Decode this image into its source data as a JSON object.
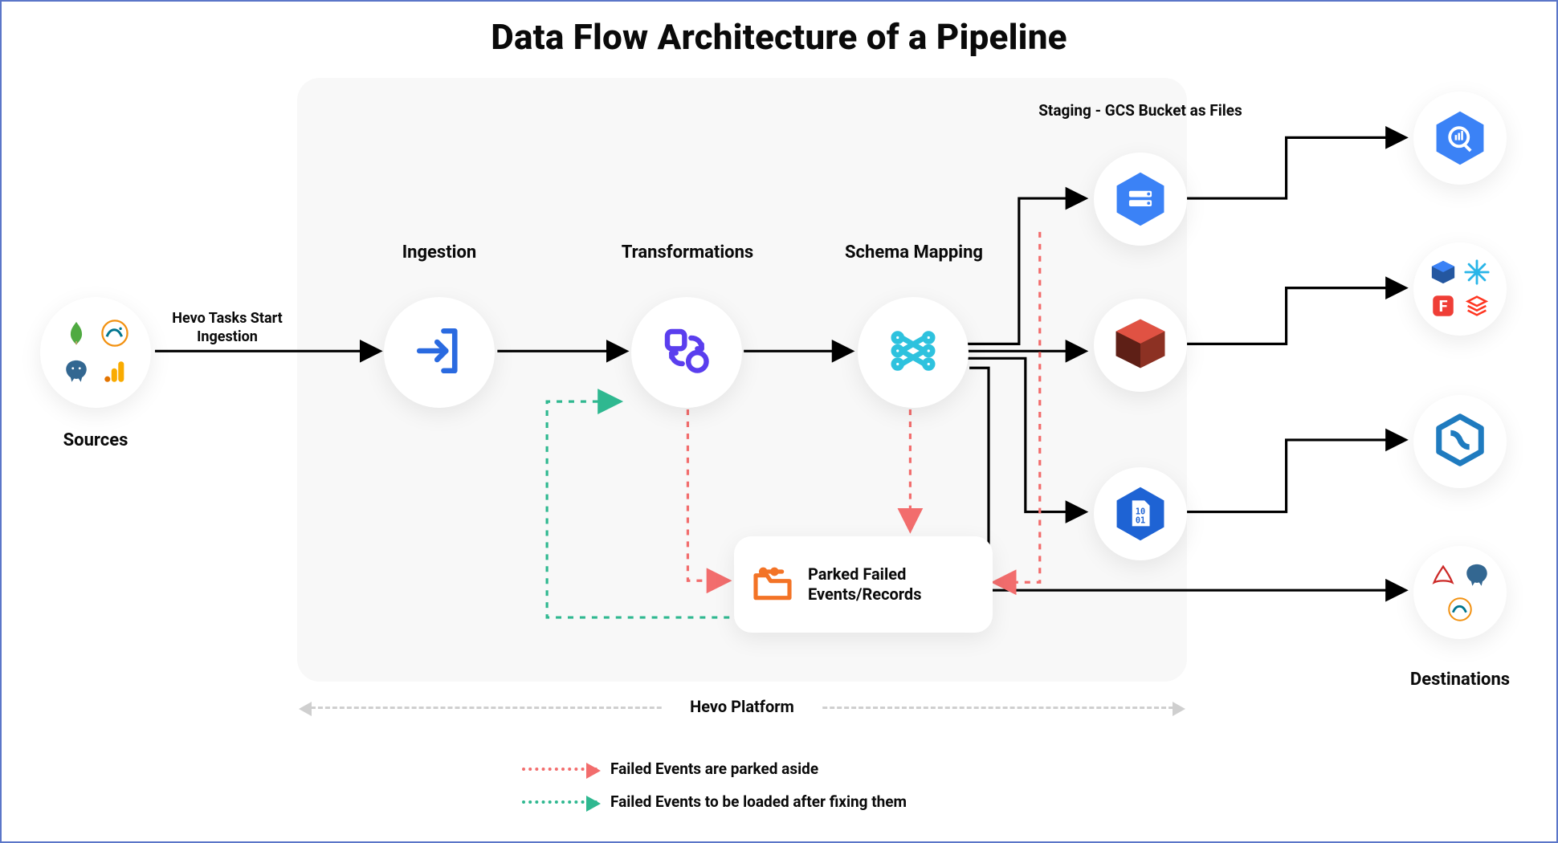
{
  "title": "Data Flow Architecture of a Pipeline",
  "platform_label": "Hevo Platform",
  "sources_label": "Sources",
  "destinations_label": "Destinations",
  "edge_ingestion_caption": "Hevo Tasks Start Ingestion",
  "stages": {
    "ingestion": "Ingestion",
    "transformations": "Transformations",
    "schema_mapping": "Schema Mapping",
    "staging": "Staging - GCS Bucket as Files"
  },
  "parked_box": {
    "line1": "Parked Failed",
    "line2": "Events/Records"
  },
  "legend": {
    "red": "Failed Events are parked aside",
    "green": "Failed Events to be loaded after fixing them"
  },
  "colors": {
    "red": "#f26d6d",
    "green": "#2fb890",
    "blue": "#2a6ae0",
    "indigo": "#5a3eee",
    "cyan": "#2ec2de",
    "orange": "#f37326"
  },
  "source_icons": [
    "mongodb",
    "mysql",
    "postgresql",
    "google-analytics"
  ],
  "staging_icons": [
    "gcs",
    "aws-s3",
    "binary-file"
  ],
  "destination_groups": [
    [
      "bigquery"
    ],
    [
      "redshift",
      "snowflake",
      "firebolt",
      "databricks"
    ],
    [
      "azure-synapse"
    ],
    [
      "sqlserver",
      "postgresql",
      "mysql"
    ]
  ]
}
